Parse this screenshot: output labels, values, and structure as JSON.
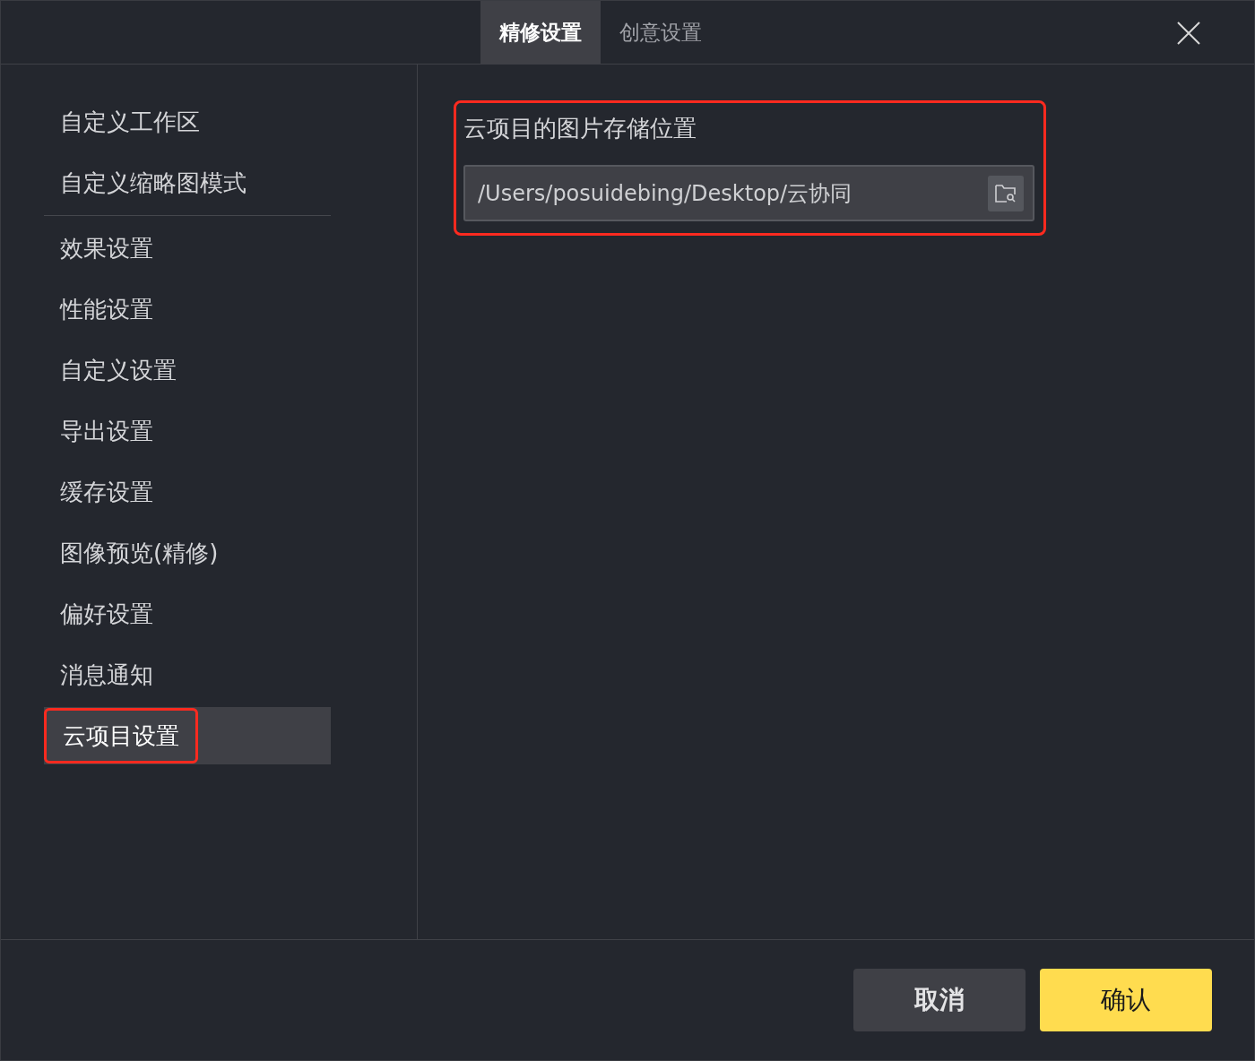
{
  "tabs": [
    {
      "label": "精修设置",
      "selected": true
    },
    {
      "label": "创意设置",
      "selected": false
    }
  ],
  "sidebar": {
    "groups": [
      [
        {
          "label": "自定义工作区",
          "selected": false,
          "highlighted": false
        },
        {
          "label": "自定义缩略图模式",
          "selected": false,
          "highlighted": false
        }
      ],
      [
        {
          "label": "效果设置",
          "selected": false,
          "highlighted": false
        },
        {
          "label": "性能设置",
          "selected": false,
          "highlighted": false
        },
        {
          "label": "自定义设置",
          "selected": false,
          "highlighted": false
        },
        {
          "label": "导出设置",
          "selected": false,
          "highlighted": false
        },
        {
          "label": "缓存设置",
          "selected": false,
          "highlighted": false
        },
        {
          "label": "图像预览(精修)",
          "selected": false,
          "highlighted": false
        },
        {
          "label": "偏好设置",
          "selected": false,
          "highlighted": false
        },
        {
          "label": "消息通知",
          "selected": false,
          "highlighted": false
        },
        {
          "label": "云项目设置",
          "selected": true,
          "highlighted": true
        }
      ]
    ]
  },
  "section": {
    "title": "云项目的图片存储位置",
    "highlighted": true,
    "path_field": {
      "value": "/Users/posuidebing/Desktop/云协同"
    }
  },
  "buttons": [
    {
      "label": "取消",
      "kind": "secondary"
    },
    {
      "label": "确认",
      "kind": "primary"
    }
  ]
}
